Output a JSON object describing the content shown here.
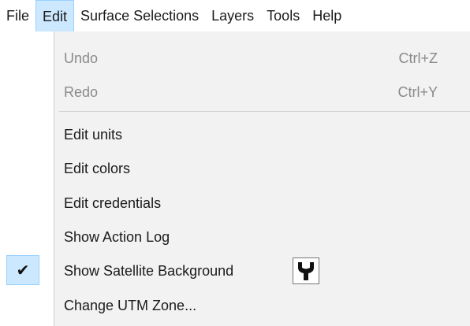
{
  "menubar": {
    "items": [
      {
        "label": "File"
      },
      {
        "label": "Edit"
      },
      {
        "label": "Surface Selections"
      },
      {
        "label": "Layers"
      },
      {
        "label": "Tools"
      },
      {
        "label": "Help"
      }
    ],
    "active": "Edit"
  },
  "edit_menu": {
    "undo": {
      "label": "Undo",
      "shortcut": "Ctrl+Z",
      "enabled": false
    },
    "redo": {
      "label": "Redo",
      "shortcut": "Ctrl+Y",
      "enabled": false
    },
    "edit_units": {
      "label": "Edit units"
    },
    "edit_colors": {
      "label": "Edit colors"
    },
    "edit_credentials": {
      "label": "Edit credentials"
    },
    "show_action_log": {
      "label": "Show Action Log"
    },
    "show_satellite_background": {
      "label": "Show Satellite Background",
      "checked": true,
      "icon": "wrench-icon"
    },
    "change_utm_zone": {
      "label": "Change UTM Zone..."
    }
  },
  "colors": {
    "highlight": "#cce8ff",
    "highlight_border": "#99d1ff",
    "menu_background": "#f2f2f2",
    "disabled_text": "#8a8a8a"
  }
}
